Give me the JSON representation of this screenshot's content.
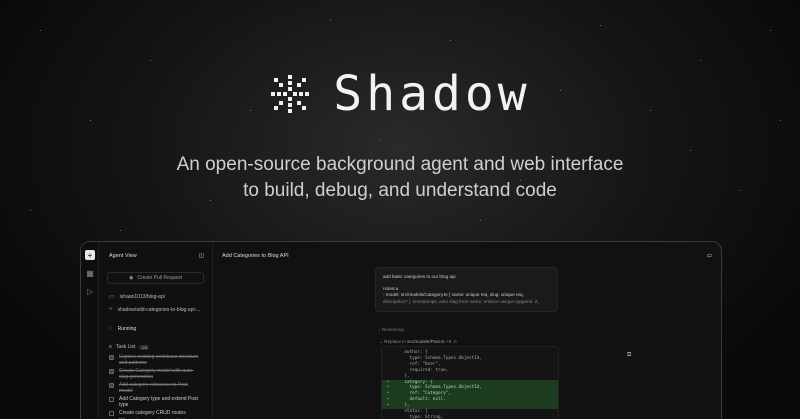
{
  "hero": {
    "brand": "Shadow",
    "tagline_line1": "An open-source background agent and web interface",
    "tagline_line2": "to build, debug, and understand code"
  },
  "app": {
    "sidebar_title": "Agent View",
    "create_pr_label": "Create Pull Request",
    "repo": "ishaan1013/blog-api",
    "branch": "shadow/add-categories-to-blog-api-...",
    "status": "Running",
    "task_list_label": "Task List",
    "task_count": "3/8",
    "tasks": [
      {
        "label": "Explore existing codebase structure and patterns",
        "done": true
      },
      {
        "label": "Create Category model with auto-slug generation",
        "done": true
      },
      {
        "label": "Add category reference to Post model",
        "done": true
      },
      {
        "label": "Add Category type and extend Post type",
        "done": false
      },
      {
        "label": "Create category CRUD routes",
        "done": false
      },
      {
        "label": "Wire category routes in index.ts",
        "done": false
      }
    ],
    "main_title": "Add Categories to Blog API",
    "message": {
      "line1": "add basic categories to our blog api",
      "line2": "notes:a",
      "line3": "- model: src/models/Category.ts { name: unique req, slug: unique req,",
      "line4": "description? }. timestamps; auto slug from name; enforce unique (append -2,"
    },
    "reasoning_label": "Reasoning",
    "replace_prefix": "Replace in",
    "replace_path": "src/models/Post.ts",
    "replace_add": "+8",
    "replace_del": "-0",
    "code_lines": [
      {
        "sign": " ",
        "text": "    author: {",
        "added": false
      },
      {
        "sign": " ",
        "text": "      type: Schema.Types.ObjectId,",
        "added": false
      },
      {
        "sign": " ",
        "text": "      ref: \"User\",",
        "added": false
      },
      {
        "sign": " ",
        "text": "      required: true,",
        "added": false
      },
      {
        "sign": " ",
        "text": "    },",
        "added": false
      },
      {
        "sign": "+",
        "text": "    category: {",
        "added": true
      },
      {
        "sign": "+",
        "text": "      type: Schema.Types.ObjectId,",
        "added": true
      },
      {
        "sign": "+",
        "text": "      ref: \"Category\",",
        "added": true
      },
      {
        "sign": "+",
        "text": "      default: null,",
        "added": true
      },
      {
        "sign": "+",
        "text": "    },",
        "added": true
      },
      {
        "sign": " ",
        "text": "    status: {",
        "added": false
      },
      {
        "sign": " ",
        "text": "      type: String,",
        "added": false
      }
    ]
  }
}
